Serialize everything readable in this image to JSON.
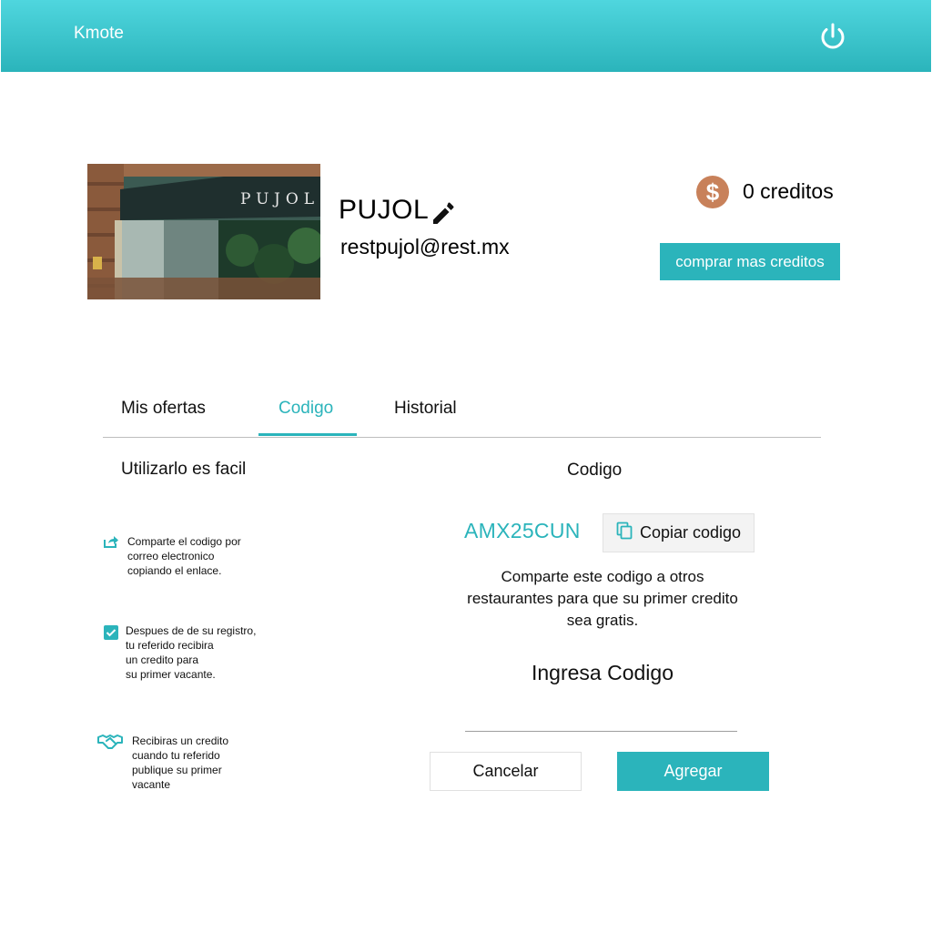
{
  "header": {
    "app_title": "Kmote",
    "power_icon": "power-icon"
  },
  "profile": {
    "name": "PUJOL",
    "email": "restpujol@rest.mx",
    "photo_sign_text": "PUJOL",
    "edit_icon": "pencil-icon"
  },
  "credits": {
    "text": "0 creditos",
    "icon": "dollar-coin-icon",
    "buy_label": "comprar mas creditos"
  },
  "tabs": [
    {
      "label": "Mis ofertas",
      "active": false
    },
    {
      "label": "Codigo",
      "active": true
    },
    {
      "label": "Historial",
      "active": false
    }
  ],
  "how_it_works": {
    "heading": "Utilizarlo es facil",
    "steps": [
      {
        "icon": "share-icon",
        "text": "Comparte el codigo por\ncorreo electronico\ncopiando el enlace."
      },
      {
        "icon": "checkbox-checked-icon",
        "text": "Despues de de su registro,\ntu referido recibira\nun credito para\nsu primer vacante."
      },
      {
        "icon": "handshake-icon",
        "text": "Recibiras un credito\ncuando tu referido\npublique su primer\nvacante"
      }
    ]
  },
  "code_panel": {
    "heading": "Codigo",
    "code": "AMX25CUN",
    "copy_label": "Copiar codigo",
    "copy_icon": "copy-icon",
    "description": "Comparte este codigo a otros restaurantes para que su primer credito sea gratis.",
    "enter_heading": "Ingresa Codigo",
    "input_value": "",
    "input_placeholder": "",
    "cancel_label": "Cancelar",
    "add_label": "Agregar"
  },
  "colors": {
    "accent": "#2bb4bb",
    "header_top": "#4fd6de",
    "coin": "#c8815a"
  }
}
